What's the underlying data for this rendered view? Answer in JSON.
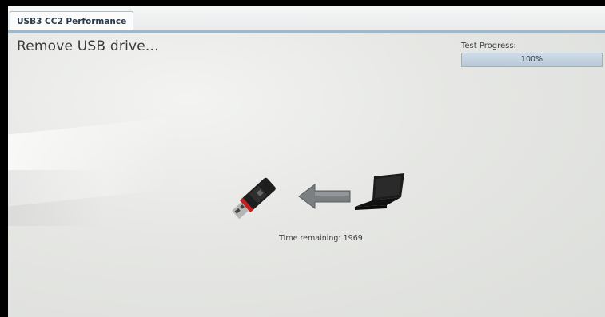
{
  "window": {
    "tab_label": "USB3 CC2 Performance"
  },
  "status": {
    "message": "Remove USB drive..."
  },
  "progress": {
    "label": "Test Progress:",
    "value_text": "100%",
    "value": 1.0
  },
  "illustration": {
    "icons": [
      "usb-drive-icon",
      "arrow-left-icon",
      "laptop-icon"
    ]
  },
  "timer": {
    "text": "Time remaining: 1969"
  }
}
